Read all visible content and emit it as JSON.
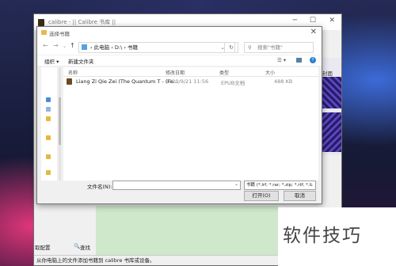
{
  "calibre": {
    "title": "calibre - || Calibre 书库 ||",
    "side_label": "封面",
    "bottom_left_1": "取配置",
    "bottom_left_2": "查找",
    "status": "从你电脑上的文件添加书籍到 calibre 书库或设备。"
  },
  "dialog": {
    "title": "选择书籍",
    "breadcrumbs": "› 此电脑 › D:\\ › 书籍",
    "search_placeholder": "搜索\"书籍\"",
    "organize_label": "组织 ▾",
    "new_folder_label": "新建文件夹",
    "columns": {
      "name": "名称",
      "date": "修改日期",
      "type": "类型",
      "size": "大小"
    },
    "files": [
      {
        "name": "Liang Zi Qie Zei (The Quantum T - (Fe...",
        "date": "2020/9/21 11:56",
        "type": "EPUB文档",
        "size": "488 KB"
      }
    ],
    "filename_label": "文件名(N):",
    "filename_value": "",
    "filetype_value": "书籍 (*.lrf; *.rar; *.zip; *.rtf; *.li",
    "open_label": "打开(O)",
    "cancel_label": "取消"
  },
  "watermark": "软件技巧"
}
